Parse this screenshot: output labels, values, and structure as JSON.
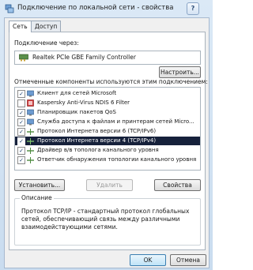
{
  "window": {
    "title": "Подключение по локальной сети - свойства",
    "help_label": "?"
  },
  "tabs": [
    {
      "label": "Сеть",
      "active": true
    },
    {
      "label": "Доступ",
      "active": false
    }
  ],
  "connect_using": {
    "label": "Подключение через:",
    "adapter": "Realtek PCIe GBE Family Controller",
    "configure_button": "Настроить..."
  },
  "components": {
    "label": "Отмеченные компоненты используются этим подключением:",
    "items": [
      {
        "label": "Клиент для сетей Microsoft",
        "checked": true,
        "icon": "network-client-icon",
        "selected": false
      },
      {
        "label": "Kaspersky Anti-Virus NDIS 6 Filter",
        "checked": false,
        "icon": "kaspersky-icon",
        "selected": false
      },
      {
        "label": "Планировщик пакетов QoS",
        "checked": true,
        "icon": "qos-icon",
        "selected": false
      },
      {
        "label": "Служба доступа к файлам и принтерам сетей Micro...",
        "checked": true,
        "icon": "file-printer-icon",
        "selected": false
      },
      {
        "label": "Протокол Интернета версии 6 (TCP/IPv6)",
        "checked": true,
        "icon": "protocol-icon",
        "selected": false
      },
      {
        "label": "Протокол Интернета версии 4 (TCP/IPv4)",
        "checked": true,
        "icon": "protocol-icon",
        "selected": true
      },
      {
        "label": "Драйвер в/в тополога канального уровня",
        "checked": true,
        "icon": "protocol-icon",
        "selected": false
      },
      {
        "label": "Ответчик обнаружения топологии канального уровня",
        "checked": true,
        "icon": "protocol-icon",
        "selected": false
      }
    ]
  },
  "actions": {
    "install": "Установить...",
    "remove": "Удалить",
    "properties": "Свойства"
  },
  "description": {
    "title": "Описание",
    "text": "Протокол TCP/IP - стандартный протокол глобальных сетей, обеспечивающий связь между различными взаимодействующими сетями."
  },
  "footer": {
    "ok": "OK",
    "cancel": "Отмена"
  },
  "colors": {
    "selection": "#16213b",
    "frame": "#c9dcef"
  }
}
